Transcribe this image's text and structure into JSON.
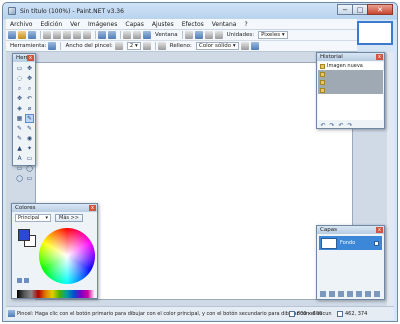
{
  "window": {
    "title": "Sin título (100%) - Paint.NET v3.36",
    "minimize": "−",
    "maximize": "□",
    "close": "✕"
  },
  "menu": [
    "Archivo",
    "Edición",
    "Ver",
    "Imágenes",
    "Capas",
    "Ajustes",
    "Efectos",
    "Ventana",
    "?"
  ],
  "toolbar": {
    "ventana_label": "Ventana",
    "unidades_label": "Unidades:",
    "unidades_value": "Pixeles"
  },
  "toolbar2": {
    "herramienta_label": "Herramienta:",
    "ancho_label": "Ancho del pincel:",
    "ancho_value": "2",
    "relleno_label": "Relleno:",
    "relleno_value": "Color sólido"
  },
  "tools_palette": {
    "title": "Herr...",
    "close": "x",
    "tools": [
      "▭",
      "✥",
      "◌",
      "✥",
      "⌕",
      "⌕",
      "✥",
      "↶",
      "◈",
      "⌀",
      "▦",
      "✎",
      "✎",
      "✎",
      "✎",
      "◉",
      "▲",
      "✦",
      "A",
      "▭",
      "▭",
      "◯",
      "◯",
      "▭"
    ]
  },
  "history_palette": {
    "title": "Historial",
    "close": "x",
    "items": [
      "Imagen nueva",
      "",
      "",
      ""
    ],
    "controls": [
      "↶",
      "↷",
      "↶",
      "↷"
    ]
  },
  "colors_palette": {
    "title": "Colores",
    "close": "x",
    "mode": "Principal",
    "more_button": "Más >>",
    "primary_color": "#2e48d6",
    "secondary_color": "#ffffff"
  },
  "layers_palette": {
    "title": "Capas",
    "close": "x",
    "layer_name": "Fondo"
  },
  "status": {
    "hint": "Pincel: Haga clic con el botón primario para dibujar con el color principal, y con el botón secundario para dibujar con el secun",
    "size": "800 x 600",
    "position": "462, 374"
  }
}
